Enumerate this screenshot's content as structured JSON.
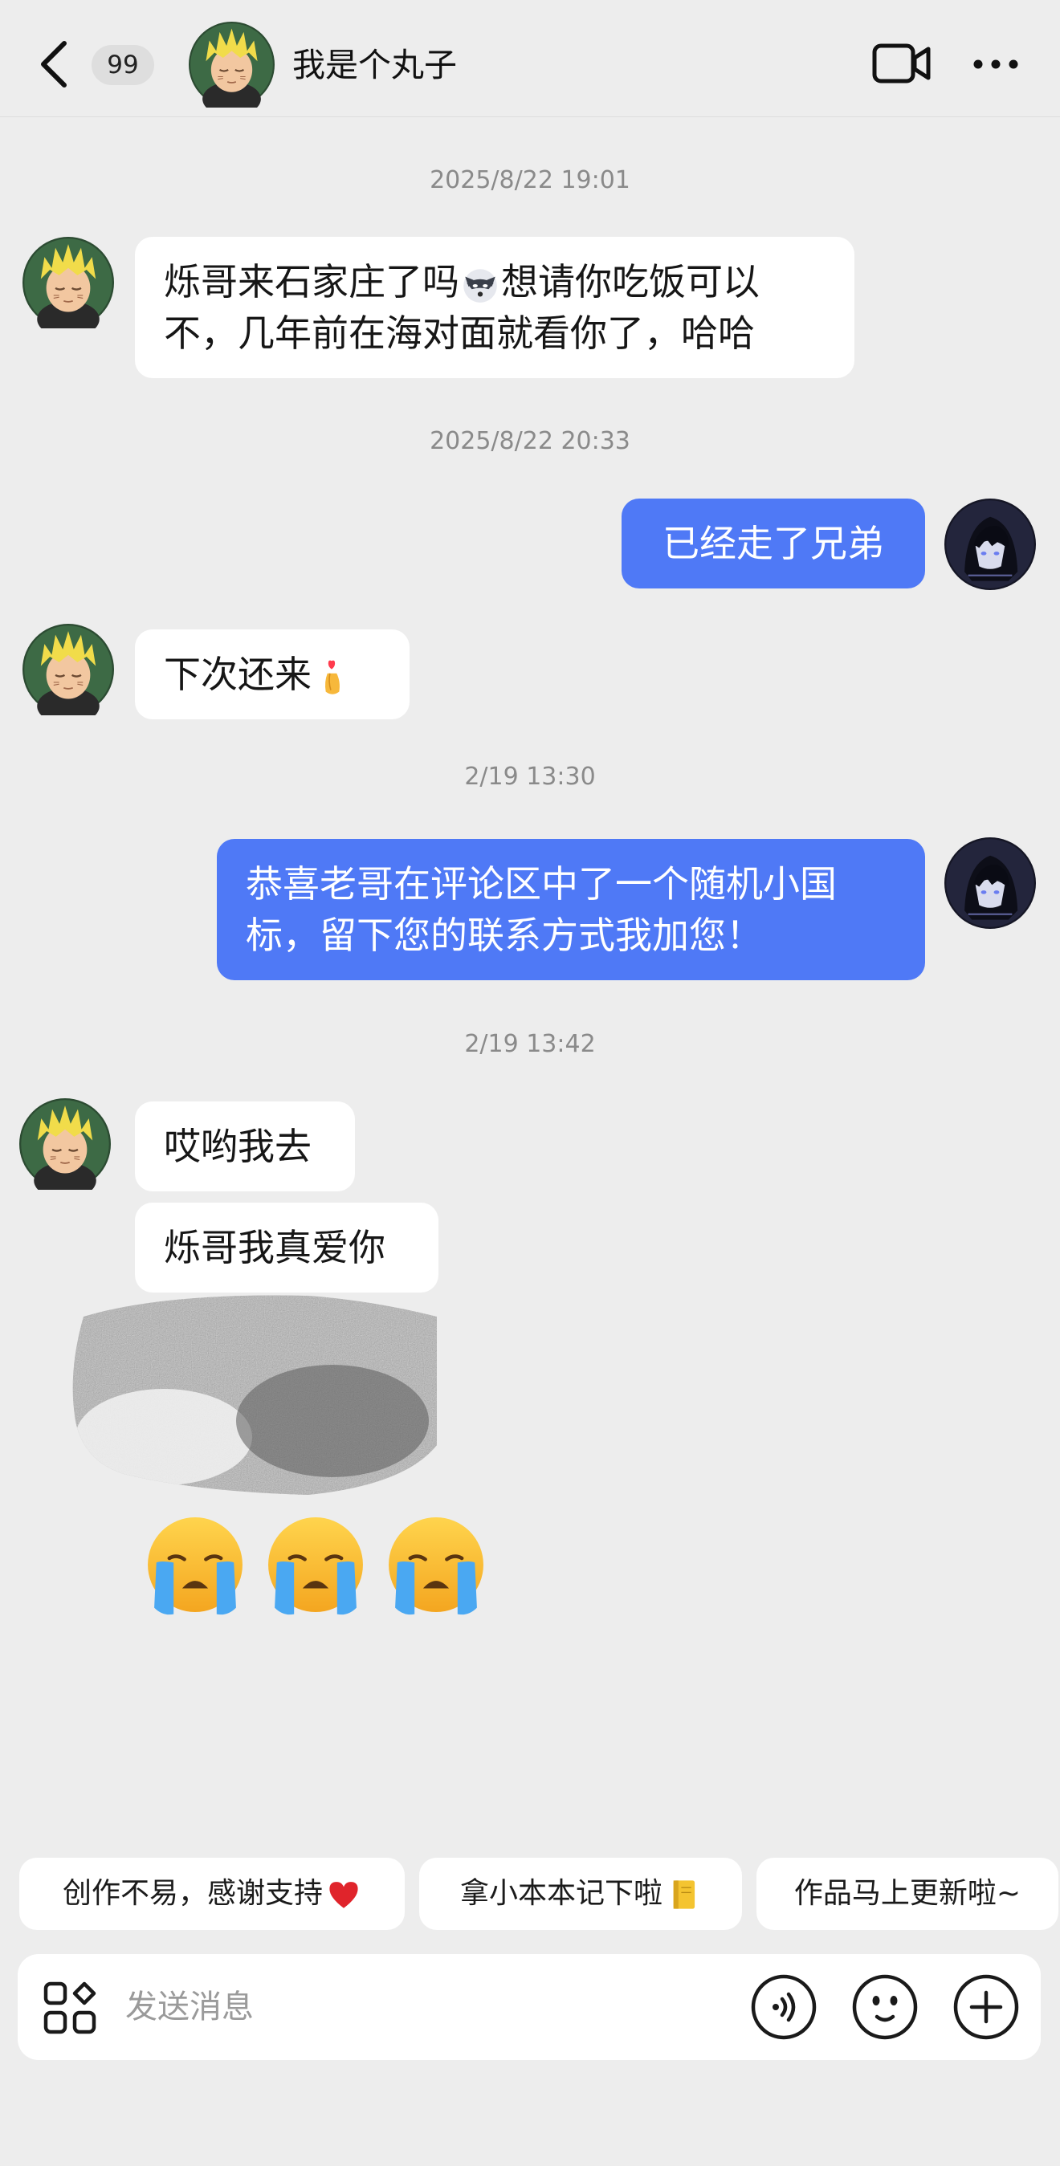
{
  "header": {
    "unread_count": "99",
    "contact_name": "我是个丸子"
  },
  "messages": {
    "ts1": "2025/8/22 19:01",
    "m1_line1": "烁哥来石家庄了吗",
    "m1_line1b": "想请你吃饭可以",
    "m1_line2": "不，几年前在海对面就看你了，哈哈",
    "ts2": "2025/8/22 20:33",
    "m2": "已经走了兄弟",
    "m3": "下次还来",
    "ts3": "2/19 13:30",
    "m4_line1": "恭喜老哥在评论区中了一个随机小国",
    "m4_line2": "标，留下您的联系方式我加您！",
    "ts4": "2/19 13:42",
    "m5": "哎哟我去",
    "m6": "烁哥我真爱你"
  },
  "quick_replies": {
    "r1": "创作不易，感谢支持",
    "r2": "拿小本本记下啦",
    "r3": "作品马上更新啦~"
  },
  "input": {
    "placeholder": "发送消息"
  },
  "icons": {
    "back": "chevron-left-icon",
    "video": "video-call-icon",
    "more": "more-dots-icon",
    "apps": "apps-grid-icon",
    "voice": "voice-icon",
    "emoji": "smiley-icon",
    "plus": "plus-icon"
  },
  "colors": {
    "outgoing_bubble": "#4f79f6",
    "incoming_bubble": "#ffffff",
    "background": "#ededed"
  }
}
